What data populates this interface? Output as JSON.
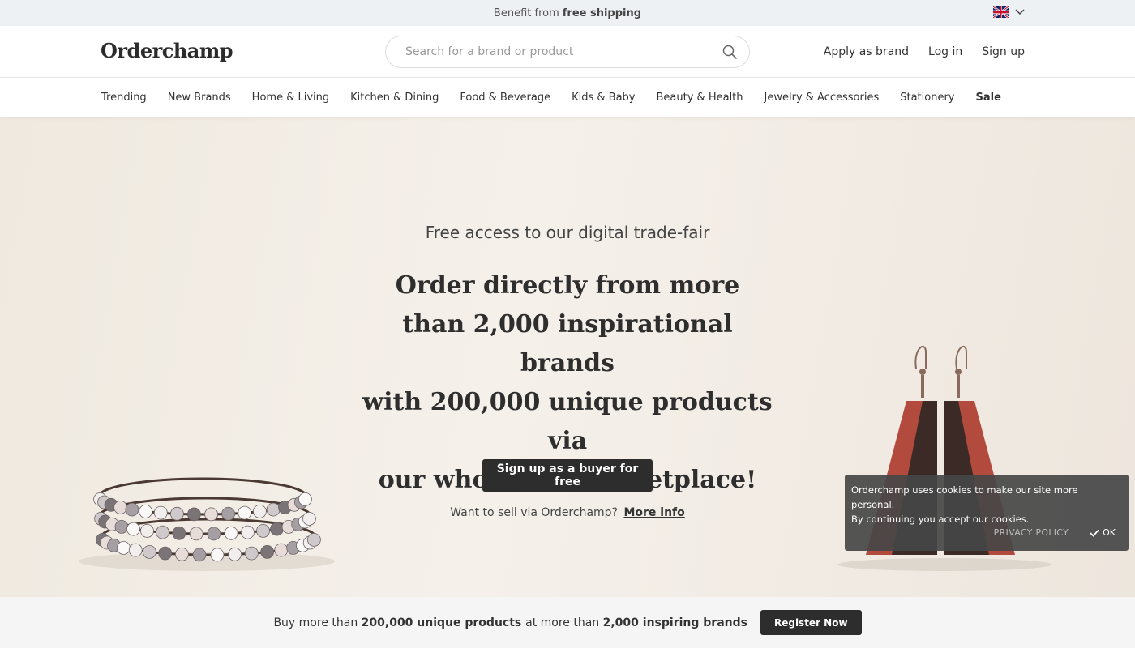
{
  "promo": {
    "text": "Benefit from",
    "bold": "free shipping"
  },
  "language": {
    "flag_icon": "uk-flag-icon",
    "chevron_icon": "chevron-down-icon"
  },
  "header": {
    "logo": "Orderchamp",
    "search": {
      "placeholder": "Search for a brand or product",
      "value": "",
      "icon": "search-icon"
    },
    "links": {
      "apply": "Apply as brand",
      "login": "Log in",
      "signup": "Sign up"
    }
  },
  "categories": [
    "Trending",
    "New Brands",
    "Home & Living",
    "Kitchen & Dining",
    "Food & Beverage",
    "Kids & Baby",
    "Beauty & Health",
    "Jewelry & Accessories",
    "Stationery",
    "Sale"
  ],
  "hero": {
    "subtitle": "Free access to our digital trade-fair",
    "title_lines": [
      "Order directly from more",
      "than 2,000 inspirational brands",
      "with 200,000 unique products via",
      "our wholesale marketplace!"
    ],
    "cta": "Sign up as a buyer for free",
    "sell_text": "Want to sell via Orderchamp?",
    "sell_link": "More info"
  },
  "cookie": {
    "line1": "Orderchamp uses cookies to make our site more personal.",
    "line2": "By continuing you accept our cookies.",
    "privacy": "PRIVACY POLICY",
    "ok": "OK"
  },
  "bottom": {
    "t1": "Buy more than",
    "b1": "200,000 unique products",
    "t2": "at more than",
    "b2": "2,000 inspiring brands",
    "button": "Register Now"
  },
  "colors": {
    "dark_button": "#2d2d2d",
    "promo_bg": "#eef1f3",
    "hero_bg": "#f2ede6",
    "bottom_bg": "#f5f5f5"
  }
}
